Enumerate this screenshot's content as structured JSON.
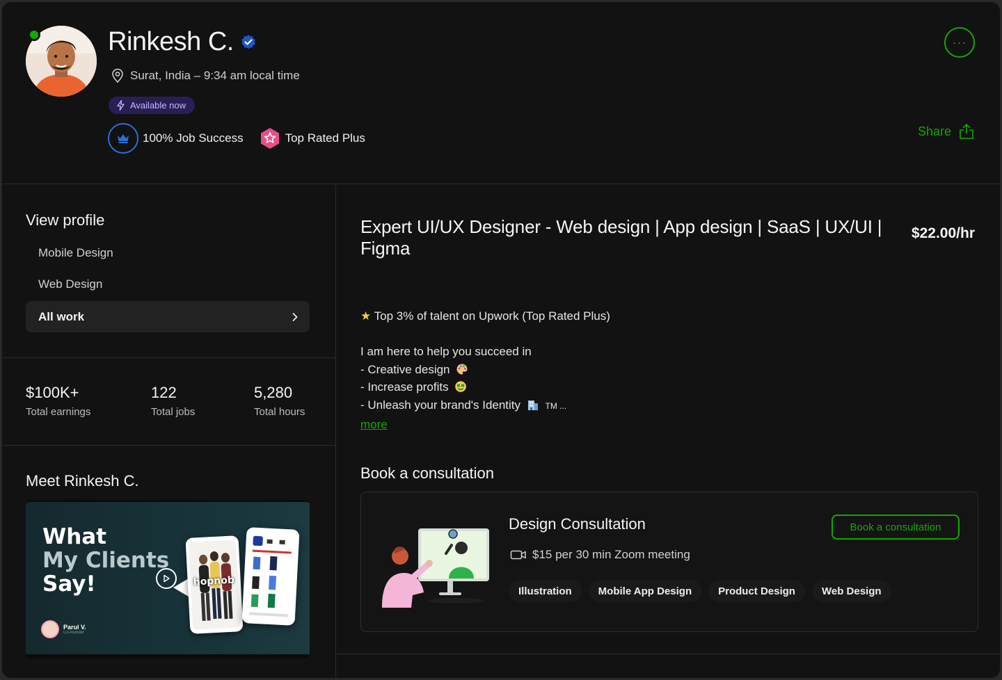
{
  "header": {
    "name": "Rinkesh C.",
    "location": "Surat, India – 9:34 am local time",
    "availability": "Available now",
    "badges": {
      "job_success": "100% Job Success",
      "top_rated": "Top Rated Plus"
    },
    "more_label": "···",
    "share_label": "Share"
  },
  "sidebar": {
    "view_profile": "View profile",
    "items": [
      "Mobile Design",
      "Web Design"
    ],
    "all_work": "All work",
    "stats": [
      {
        "value": "$100K+",
        "label": "Total earnings"
      },
      {
        "value": "122",
        "label": "Total jobs"
      },
      {
        "value": "5,280",
        "label": "Total hours"
      }
    ],
    "meet_title": "Meet Rinkesh C.",
    "video": {
      "line1": "What",
      "line2": "My Clients",
      "line3": "Say!",
      "brand": "hopnob",
      "person_name": "Parul V.",
      "person_role": "Co-founder"
    }
  },
  "main": {
    "title": "Expert UI/UX Designer - Web design | App design | SaaS | UX/UI | Figma",
    "rate": "$22.00/hr",
    "overview": {
      "highlight": "Top 3% of talent on Upwork (Top Rated Plus)",
      "intro": "I am here to help you succeed in",
      "points": [
        "- Creative design",
        "- Increase profits",
        "- Unleash your brand's Identity"
      ],
      "tm": "TM ...",
      "more_label": "more"
    },
    "consultation": {
      "heading": "Book a consultation",
      "title": "Design Consultation",
      "meta": "$15 per 30 min Zoom meeting",
      "button": "Book a consultation",
      "tags": [
        "Illustration",
        "Mobile App Design",
        "Product Design",
        "Web Design"
      ]
    }
  },
  "colors": {
    "accent_green": "#14a800",
    "background": "#121212",
    "verified_blue": "#1f57c3",
    "available_bg": "#2a1f55",
    "top_rated_pink": "#e94e8a"
  }
}
